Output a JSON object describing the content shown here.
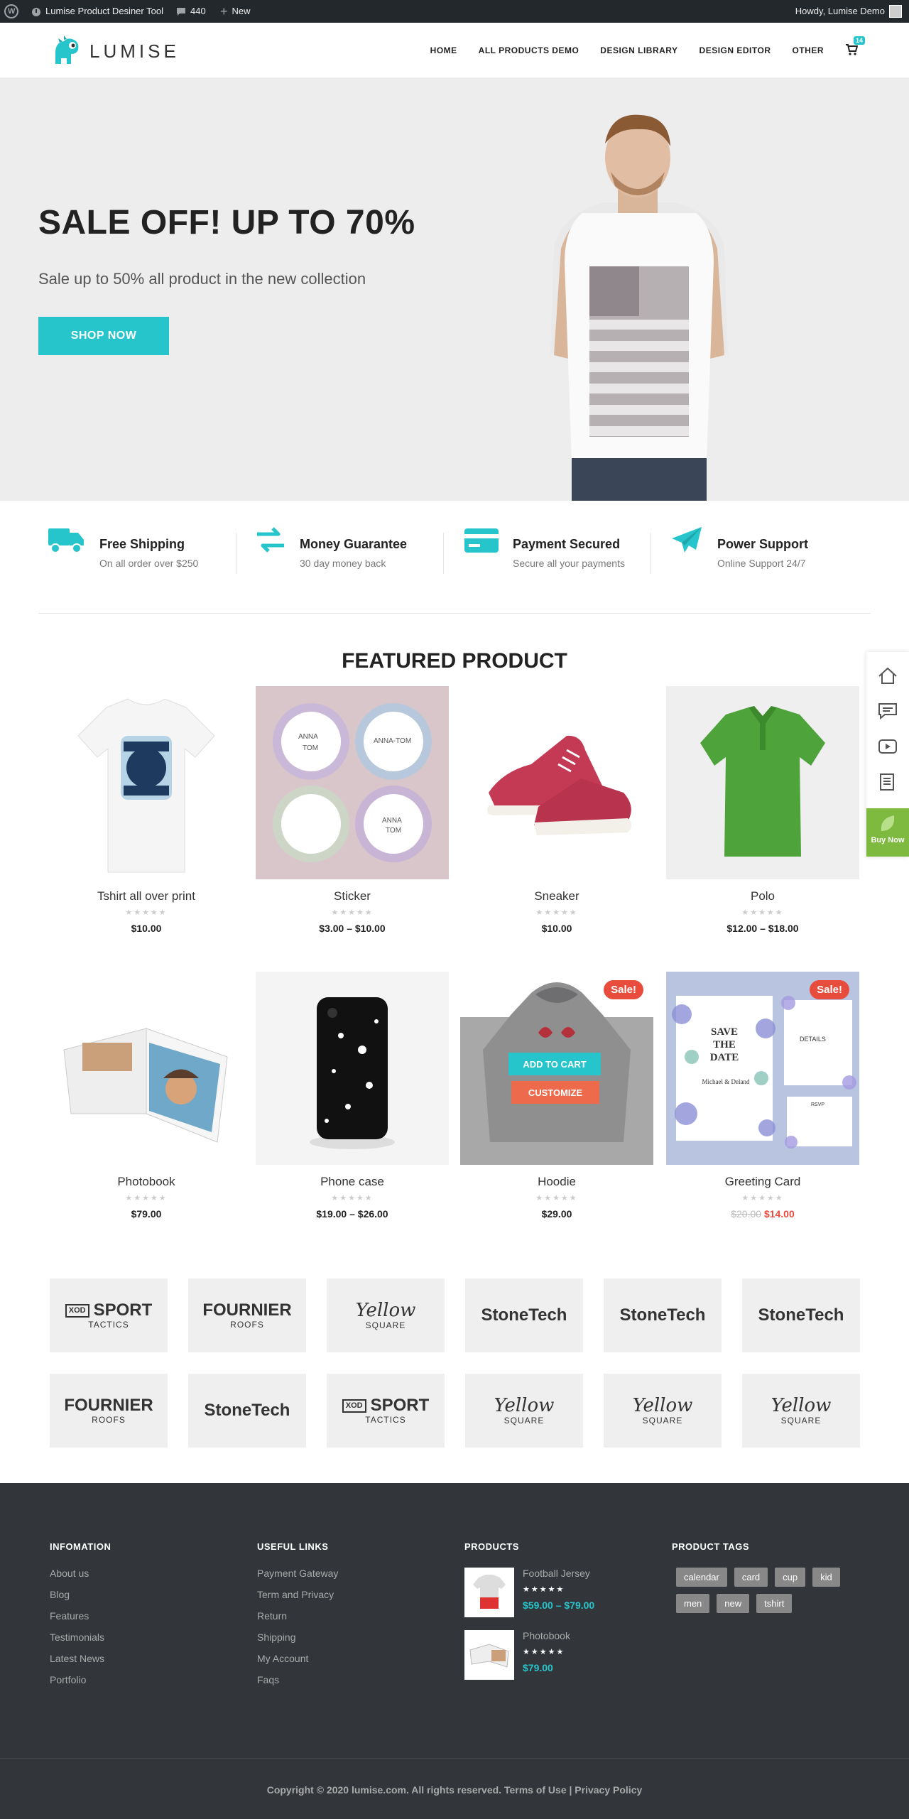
{
  "adminbar": {
    "site_name": "Lumise Product Desiner Tool",
    "comments": "440",
    "new_label": "New",
    "howdy": "Howdy, Lumise Demo"
  },
  "header": {
    "logo": "LUMISE",
    "nav": [
      "HOME",
      "ALL PRODUCTS DEMO",
      "DESIGN LIBRARY",
      "DESIGN EDITOR",
      "OTHER"
    ],
    "cart_count": "14"
  },
  "hero": {
    "title": "SALE OFF! UP TO 70%",
    "subtitle": "Sale up to 50% all product in the new collection",
    "button": "SHOP NOW"
  },
  "features": [
    {
      "title": "Free Shipping",
      "sub": "On all order over $250",
      "icon": "truck-icon"
    },
    {
      "title": "Money Guarantee",
      "sub": "30 day money back",
      "icon": "exchange-icon"
    },
    {
      "title": "Payment Secured",
      "sub": "Secure all your payments",
      "icon": "credit-card-icon"
    },
    {
      "title": "Power Support",
      "sub": "Online Support 24/7",
      "icon": "paper-plane-icon"
    }
  ],
  "featured": {
    "title": "FEATURED PRODUCT",
    "products": [
      {
        "name": "Tshirt all over print",
        "price": "$10.00"
      },
      {
        "name": "Sticker",
        "price": "$3.00 – $10.00"
      },
      {
        "name": "Sneaker",
        "price": "$10.00"
      },
      {
        "name": "Polo",
        "price": "$12.00 – $18.00"
      },
      {
        "name": "Photobook",
        "price": "$79.00"
      },
      {
        "name": "Phone case",
        "price": "$19.00 – $26.00"
      },
      {
        "name": "Hoodie",
        "price": "$29.00",
        "sale": "Sale!",
        "add_to_cart": "ADD TO CART",
        "customize": "CUSTOMIZE"
      },
      {
        "name": "Greeting Card",
        "old_price": "$20.00",
        "price": "$14.00",
        "sale": "Sale!"
      }
    ],
    "sticker_text": [
      "ANNA",
      "TOM",
      "ANNA-TOM",
      "ANNA",
      "TOM"
    ],
    "card_text": [
      "SAVE THE DATE",
      "Michael & Deland",
      "DETAILS",
      "RSVP"
    ]
  },
  "brands": [
    {
      "name": "SPORT",
      "sub": "TACTICS",
      "mark": "XOD"
    },
    {
      "name": "FOURNIER",
      "sub": "ROOFS"
    },
    {
      "name": "Yellow",
      "sub": "SQUARE"
    },
    {
      "name": "StoneTech",
      "sub": ""
    },
    {
      "name": "StoneTech",
      "sub": ""
    },
    {
      "name": "StoneTech",
      "sub": ""
    },
    {
      "name": "FOURNIER",
      "sub": "ROOFS"
    },
    {
      "name": "StoneTech",
      "sub": ""
    },
    {
      "name": "SPORT",
      "sub": "TACTICS",
      "mark": "XOD"
    },
    {
      "name": "Yellow",
      "sub": "SQUARE"
    },
    {
      "name": "Yellow",
      "sub": "SQUARE"
    },
    {
      "name": "Yellow",
      "sub": "SQUARE"
    }
  ],
  "footer": {
    "info_title": "INFOMATION",
    "info_links": [
      "About us",
      "Blog",
      "Features",
      "Testimonials",
      "Latest News",
      "Portfolio"
    ],
    "useful_title": "USEFUL LINKS",
    "useful_links": [
      "Payment Gateway",
      "Term and Privacy",
      "Return",
      "Shipping",
      "My Account",
      "Faqs"
    ],
    "products_title": "PRODUCTS",
    "products": [
      {
        "name": "Football Jersey",
        "price": "$59.00 – $79.00"
      },
      {
        "name": "Photobook",
        "price": "$79.00"
      }
    ],
    "tags_title": "PRODUCT TAGS",
    "tags": [
      "calendar",
      "card",
      "cup",
      "kid",
      "men",
      "new",
      "tshirt"
    ],
    "copyright": "Copyright © 2020 lumise.com. All rights reserved. Terms of Use | Privacy Policy"
  },
  "float_sidebar": {
    "buy_now": "Buy Now"
  },
  "colors": {
    "accent": "#26c5cb",
    "sale": "#e84c3d",
    "customize": "#ee6a4c",
    "footer_bg": "#32363a",
    "buy_now": "#7dba3f"
  }
}
